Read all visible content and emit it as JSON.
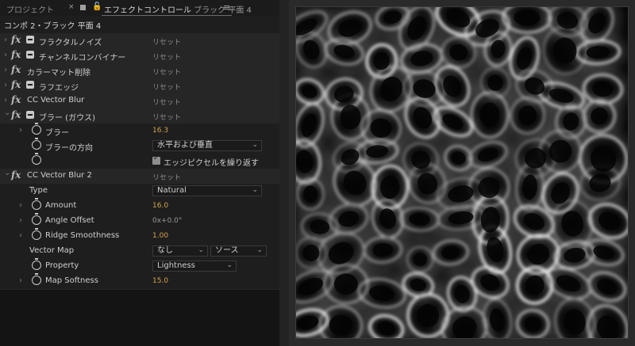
{
  "tabs": {
    "project_label": "プロジェクト",
    "close_glyph": "×",
    "effect_controls_label": "エフェクトコントロール",
    "effect_controls_target": "ブラック 平面 4",
    "menu_glyph": "≡"
  },
  "breadcrumb": "コンポ 2・ブラック 平面 4",
  "reset_label": "リセット",
  "effects": [
    {
      "name": "フラクタルノイズ"
    },
    {
      "name": "チャンネルコンバイナー"
    },
    {
      "name": "カラーマット削除"
    },
    {
      "name": "ラフエッジ"
    },
    {
      "name": "CC Vector Blur"
    },
    {
      "name": "ブラー (ガウス)"
    },
    {
      "name": "CC Vector Blur 2"
    }
  ],
  "blur_props": {
    "blurriness_label": "ブラー",
    "blurriness_value": "16.3",
    "direction_label": "ブラーの方向",
    "direction_value": "水平および垂直",
    "repeat_edge_label": "エッジピクセルを繰り返す"
  },
  "vector_blur2_props": {
    "type_label": "Type",
    "type_value": "Natural",
    "amount_label": "Amount",
    "amount_value": "16.0",
    "angle_label": "Angle Offset",
    "angle_value": "0x+0.0°",
    "ridge_label": "Ridge Smoothness",
    "ridge_value": "1.00",
    "vector_map_label": "Vector Map",
    "vector_map_value": "なし",
    "vector_map_source": "ソース",
    "property_label": "Property",
    "property_value": "Lightness",
    "map_softness_label": "Map Softness",
    "map_softness_value": "15.0"
  },
  "glyphs": {
    "expand": "›",
    "collapse": "⌄",
    "fx": "fx",
    "caret": "⌄"
  }
}
